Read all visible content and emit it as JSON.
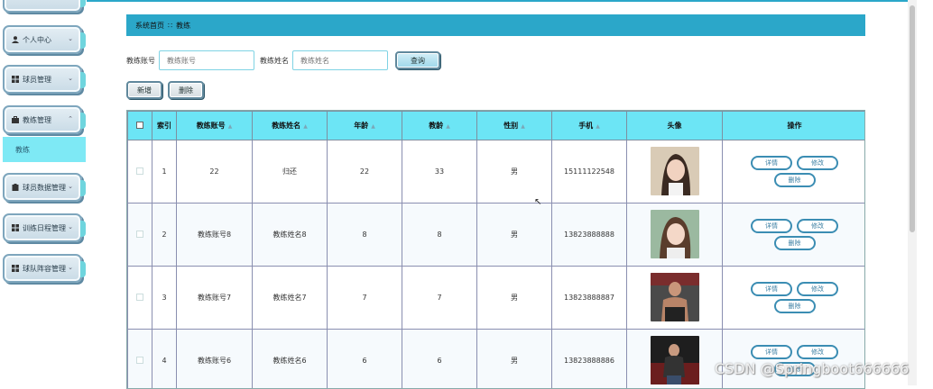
{
  "sidebar": {
    "items": [
      {
        "label": "个人中心",
        "icon": "user-icon"
      },
      {
        "label": "球员管理",
        "icon": "grid-icon"
      },
      {
        "label": "教练管理",
        "icon": "briefcase-icon"
      },
      {
        "label": "球员数据管理",
        "icon": "clipboard-icon"
      },
      {
        "label": "训练日程管理",
        "icon": "grid-icon"
      },
      {
        "label": "球队阵容管理",
        "icon": "grid-icon"
      }
    ],
    "active_sub": "教练"
  },
  "breadcrumb": {
    "home": "系统首页",
    "separator": "∷",
    "current": "教练"
  },
  "search": {
    "account_label": "教练账号",
    "account_placeholder": "教练账号",
    "name_label": "教练姓名",
    "name_placeholder": "教练姓名",
    "button": "查询"
  },
  "actions": {
    "add": "新增",
    "delete": "删除"
  },
  "table": {
    "headers": [
      "索引",
      "教练账号",
      "教练姓名",
      "年龄",
      "教龄",
      "性别",
      "手机",
      "头像",
      "操作"
    ],
    "rows": [
      {
        "index": "1",
        "account": "22",
        "name": "归还",
        "age": "22",
        "years": "33",
        "gender": "男",
        "phone": "15111122548"
      },
      {
        "index": "2",
        "account": "教练账号8",
        "name": "教练姓名8",
        "age": "8",
        "years": "8",
        "gender": "男",
        "phone": "13823888888"
      },
      {
        "index": "3",
        "account": "教练账号7",
        "name": "教练姓名7",
        "age": "7",
        "years": "7",
        "gender": "男",
        "phone": "13823888887"
      },
      {
        "index": "4",
        "account": "教练账号6",
        "name": "教练姓名6",
        "age": "6",
        "years": "6",
        "gender": "男",
        "phone": "13823888886"
      }
    ],
    "ops": {
      "detail": "详情",
      "edit": "修改",
      "delete": "删除"
    }
  },
  "watermark": "CSDN @Springboot666666",
  "colors": {
    "accent": "#2ba7c9",
    "header_bg": "#6ce5f5",
    "active_sub": "#7ee9f5"
  }
}
